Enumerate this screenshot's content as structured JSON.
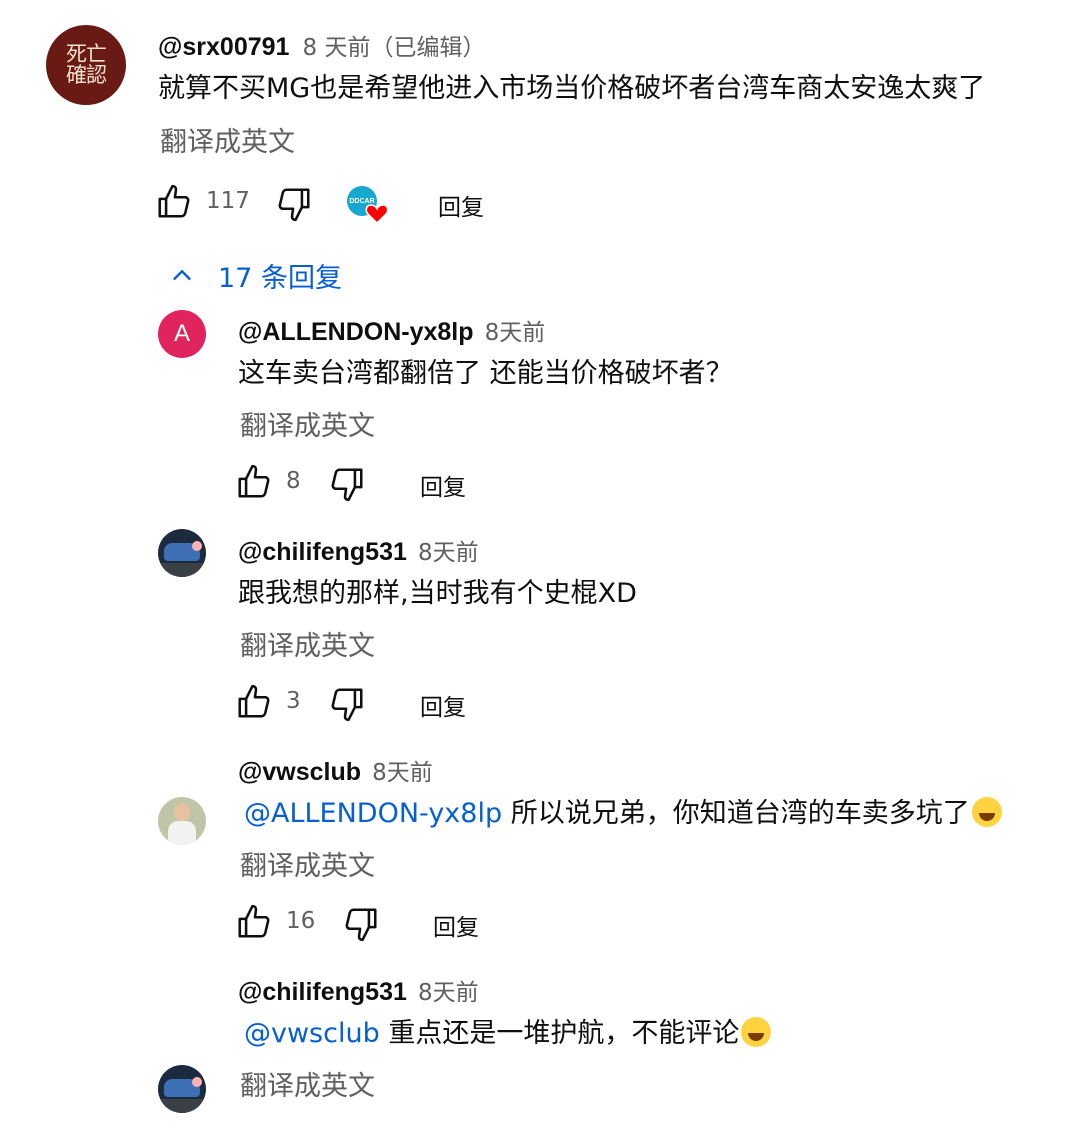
{
  "main_comment": {
    "avatar_text": "死亡\n確認",
    "author": "@srx00791",
    "time": "8 天前（已编辑）",
    "text": "就算不买MG也是希望他进入市场当价格破坏者台湾车商太安逸太爽了",
    "translate": "翻译成英文",
    "likes": "117",
    "creator_badge_text": "DDCAR",
    "reply_label": "回复"
  },
  "replies_toggle": "17 条回复",
  "replies": [
    {
      "author": "@ALLENDON-yx8lp",
      "time": "8天前",
      "avatar_letter": "A",
      "mention": "",
      "text": "这车卖台湾都翻倍了 还能当价格破坏者？",
      "translate": "翻译成英文",
      "likes": "8",
      "reply_label": "回复"
    },
    {
      "author": "@chilifeng531",
      "time": "8天前",
      "mention": "",
      "text": "跟我想的那样,当时我有个史棍XD",
      "translate": "翻译成英文",
      "likes": "3",
      "reply_label": "回复"
    },
    {
      "author": "@vwsclub",
      "time": "8天前",
      "mention": "@ALLENDON-yx8lp",
      "text": "所以说兄弟，你知道台湾的车卖多坑了",
      "emoji": "joy-emoji",
      "translate": "翻译成英文",
      "likes": "16",
      "reply_label": "回复"
    },
    {
      "author": "@chilifeng531",
      "time": "8天前",
      "mention": "@vwsclub",
      "text": "重点还是一堆护航，不能评论",
      "emoji": "laughing-emoji",
      "translate": "翻译成英文"
    }
  ],
  "colors": {
    "link": "#065fd4",
    "secondary_text": "#606060",
    "heart": "#ff0000",
    "avatar_letter_bg": "#e0245e"
  }
}
